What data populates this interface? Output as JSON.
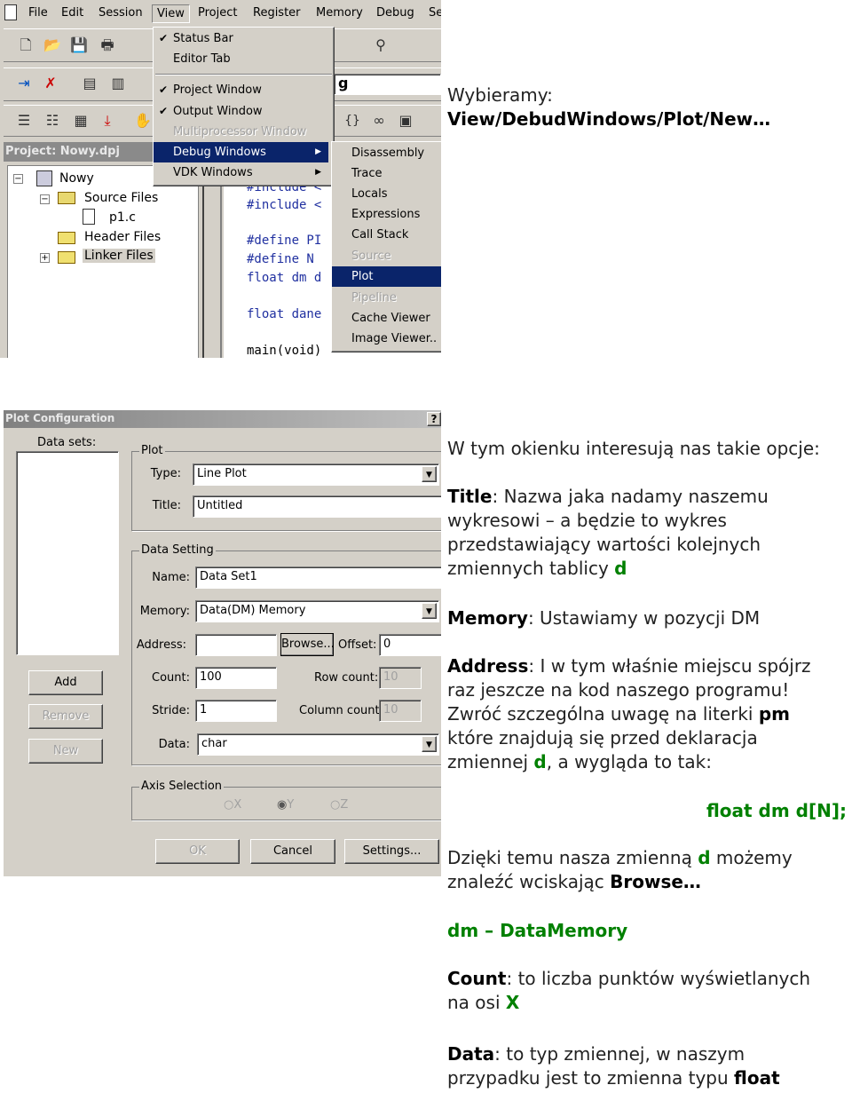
{
  "screenshot1": {
    "menubar": [
      "File",
      "Edit",
      "Session",
      "View",
      "Project",
      "Register",
      "Memory",
      "Debug",
      "Se"
    ],
    "project_title": "Project: Nowy.dpj",
    "tree": {
      "root": "Nowy",
      "items": [
        "Source Files",
        "p1.c",
        "Header Files",
        "Linker Files"
      ]
    },
    "combo_fragment": "g",
    "code_lines": [
      "#include <",
      "#include <",
      "#define PI",
      "#define N",
      "float dm d",
      "float dane",
      "main(void)"
    ],
    "view_menu": [
      {
        "label": "Status Bar",
        "checked": true
      },
      {
        "label": "Editor Tab",
        "checked": false
      },
      {
        "label": "Project Window",
        "checked": true
      },
      {
        "label": "Output Window",
        "checked": true
      },
      {
        "label": "Multiprocessor Window",
        "disabled": true
      },
      {
        "label": "Debug Windows",
        "highlighted": true,
        "submenu": true
      },
      {
        "label": "VDK Windows",
        "submenu": true
      }
    ],
    "debug_submenu": [
      {
        "label": "Disassembly"
      },
      {
        "label": "Trace"
      },
      {
        "label": "Locals"
      },
      {
        "label": "Expressions"
      },
      {
        "label": "Call Stack"
      },
      {
        "label": "Source",
        "disabled": true
      },
      {
        "label": "Plot",
        "highlighted": true
      },
      {
        "label": "Pipeline",
        "disabled": true
      },
      {
        "label": "Cache Viewer"
      },
      {
        "label": "Image Viewer.."
      }
    ],
    "highlight_color": "#0a246a"
  },
  "dialog": {
    "title": "Plot Configuration",
    "help": "?",
    "data_sets_label": "Data sets:",
    "add": "Add",
    "remove": "Remove",
    "new": "New",
    "plot_group": "Plot",
    "type_label": "Type:",
    "type_value": "Line Plot",
    "title_label": "Title:",
    "title_value": "Untitled",
    "data_group": "Data Setting",
    "name_label": "Name:",
    "name_value": "Data Set1",
    "memory_label": "Memory:",
    "memory_value": "Data(DM) Memory",
    "address_label": "Address:",
    "address_value": "",
    "browse": "Browse...",
    "offset_label": "Offset:",
    "offset_value": "0",
    "count_label": "Count:",
    "count_value": "100",
    "row_count_label": "Row count:",
    "row_count_value": "10",
    "stride_label": "Stride:",
    "stride_value": "1",
    "column_count_label": "Column count:",
    "column_count_value": "10",
    "data_label": "Data:",
    "data_value": "char",
    "axis_group": "Axis Selection",
    "axes": [
      {
        "label": "X",
        "checked": false
      },
      {
        "label": "Y",
        "checked": true
      },
      {
        "label": "Z",
        "checked": false
      }
    ],
    "ok": "OK",
    "cancel": "Cancel",
    "settings": "Settings..."
  },
  "text": {
    "intro1": "Wybieramy:",
    "intro2": "View/DebudWindows/Plot/New…",
    "options": "W tym okienku interesują nas takie opcje:",
    "title_b": "Title",
    "title_t1": ": Nazwa jaka nadamy naszemu",
    "title_t2": "wykresowi – a będzie to wykres",
    "title_t3": "przedstawiający wartości kolejnych",
    "title_t4": "zmiennych tablicy ",
    "title_d": "d",
    "memory_b": "Memory",
    "memory_t": ": Ustawiamy w pozycji DM",
    "address_b": "Address",
    "address_t1": ": I w tym właśnie miejscu spójrz",
    "address_t2": "raz jeszcze na kod naszego programu!",
    "address_t3": "Zwróć szczególna uwagę na literki ",
    "address_pm": "pm",
    "address_t4": "które znajdują się przed deklaracja",
    "address_t5": "zmiennej ",
    "address_d": "d",
    "address_t6": ", a wygląda to tak:",
    "code": "float dm d[N];",
    "thanks_t1": "Dzięki temu nasza zmienną ",
    "thanks_d": "d",
    "thanks_t2": " możemy",
    "thanks_t3": "znaleźć wciskając ",
    "thanks_b": "Browse…",
    "dm": "dm – DataMemory",
    "count_b": "Count",
    "count_t1": ": to liczba punktów wyświetlanych",
    "count_t2": "na osi ",
    "count_x": "X",
    "data_b": "Data",
    "data_t1": ": to typ zmiennej, w naszym",
    "data_t2": "przypadku jest to zmienna typu ",
    "data_float": "float",
    "accent_green": "#008000"
  }
}
